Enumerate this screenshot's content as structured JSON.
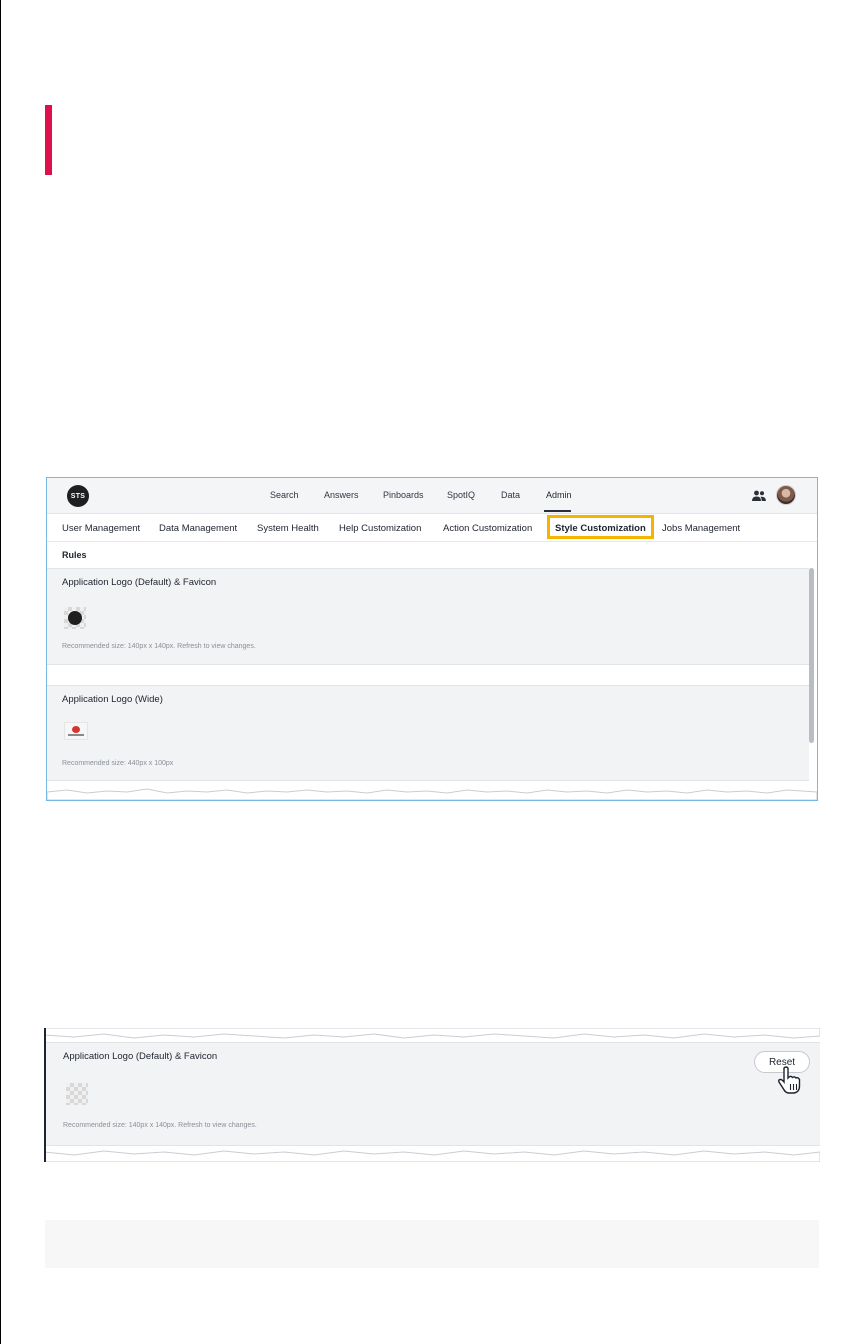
{
  "colors": {
    "accent": "#e0104f",
    "highlight": "#f4b400",
    "panel_bg": "#f2f3f5"
  },
  "shot1": {
    "logo_text": "STS",
    "topnav": [
      "Search",
      "Answers",
      "Pinboards",
      "SpotIQ",
      "Data",
      "Admin"
    ],
    "active_nav": "Admin",
    "icons": [
      "people-icon",
      "avatar"
    ],
    "subnav": [
      "User Management",
      "Data Management",
      "System Health",
      "Help Customization",
      "Action Customization",
      "Style Customization",
      "Jobs Management"
    ],
    "selected_subnav": "Style Customization",
    "section_heading": "Rules",
    "panels": [
      {
        "title": "Application Logo (Default) & Favicon",
        "note": "Recommended size: 140px x 140px. Refresh to view changes."
      },
      {
        "title": "Application Logo (Wide)",
        "note": "Recommended size: 440px x 100px"
      }
    ]
  },
  "shot2": {
    "title": "Application Logo (Default) & Favicon",
    "note": "Recommended size: 140px x 140px. Refresh to view changes.",
    "reset_label": "Reset",
    "cursor_icon": "hand-pointer-icon"
  }
}
